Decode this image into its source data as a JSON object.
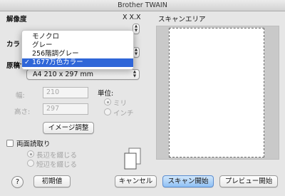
{
  "window": {
    "title": "Brother TWAIN"
  },
  "resolution": {
    "label": "解像度",
    "value_partial": "X X.X"
  },
  "color_mode": {
    "label_partial": "カラ",
    "options": [
      "モノクロ",
      "グレー",
      "256階調グレー",
      "1677万色カラー"
    ],
    "selected_index": 3,
    "check_mark": "✓"
  },
  "document_size": {
    "label": "原稿サイズ",
    "value": "A4  210 x 297 mm"
  },
  "dimensions": {
    "width_label": "幅:",
    "width_value": "210",
    "height_label": "高さ:",
    "height_value": "297"
  },
  "unit": {
    "label": "単位:",
    "options": [
      "ミリ",
      "インチ"
    ],
    "selected_index": 0
  },
  "buttons": {
    "image_adjust": "イメージ調整",
    "defaults": "初期値",
    "cancel": "キャンセル",
    "scan_start": "スキャン開始",
    "preview_start": "プレビュー開始",
    "help": "?"
  },
  "duplex": {
    "label": "両面読取り",
    "checked": false,
    "options": [
      "長辺を綴じる",
      "短辺を綴じる"
    ],
    "selected_index": 0
  },
  "scan_area": {
    "label": "スキャンエリア"
  },
  "colors": {
    "accent": "#2f66d8",
    "primary_button": "#8fc0f4"
  }
}
